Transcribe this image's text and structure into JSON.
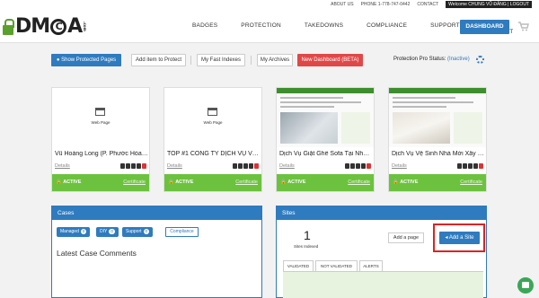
{
  "topbar": {
    "about": "ABOUT US",
    "phone": "PHONE 1-778-747-0442",
    "contact": "CONTACT",
    "welcome": "Welcome CHUNG VŨ ĐĂNG | LOGOUT"
  },
  "header": {
    "logo": {
      "left": "DMCA",
      "com": ".com"
    },
    "nav": [
      "BADGES",
      "PROTECTION",
      "TAKEDOWNS",
      "COMPLIANCE",
      "SUPPORT",
      "MY ACCOUNT"
    ],
    "dashboard": "DASHBOARD"
  },
  "toolbar": {
    "show_protected": "Show Protected Pages",
    "add_item": "Add item to Protect",
    "fast_indexes": "My Fast Indexes",
    "archives": "My Archives",
    "new_dashboard": "New Dashboard (BETA)",
    "status_label": "Protection Pro Status:",
    "status_value": "(Inactive)"
  },
  "cards": [
    {
      "thumb_label": "Web Page",
      "title": "Vũ Hoàng Long (P. Phước Hòa, ...",
      "details": "Details",
      "status": "ACTIVE",
      "certificate": "Certificate"
    },
    {
      "thumb_label": "Web Page",
      "title": "TOP #1 CÔNG TY DỊCH VỤ VỆ ...",
      "details": "Details",
      "status": "ACTIVE",
      "certificate": "Certificate"
    },
    {
      "title": "Dịch Vụ Giặt Ghế Sofa Tại Nhà ...",
      "details": "Details",
      "status": "ACTIVE",
      "certificate": "Certificate"
    },
    {
      "title": "Dịch Vụ Vệ Sinh Nhà Mới Xây D...",
      "details": "Details",
      "status": "ACTIVE",
      "certificate": "Certificate"
    }
  ],
  "cases": {
    "header": "Cases",
    "managed": {
      "label": "Managed",
      "count": "0"
    },
    "diy": {
      "label": "DIY",
      "count": "0"
    },
    "support": {
      "label": "Support",
      "count": "0"
    },
    "compliance": "Compliance",
    "latest": "Latest Case Comments"
  },
  "sites": {
    "header": "Sites",
    "count": "1",
    "count_label": "Sites Indexed",
    "add_page": "Add a page",
    "add_site": "Add a Site",
    "tabs": [
      "VALIDATED",
      "NOT VALIDATED",
      "ALERTS"
    ]
  },
  "colors": {
    "primary": "#2f7bbf",
    "active_green": "#6cc23e",
    "danger": "#e04848"
  }
}
